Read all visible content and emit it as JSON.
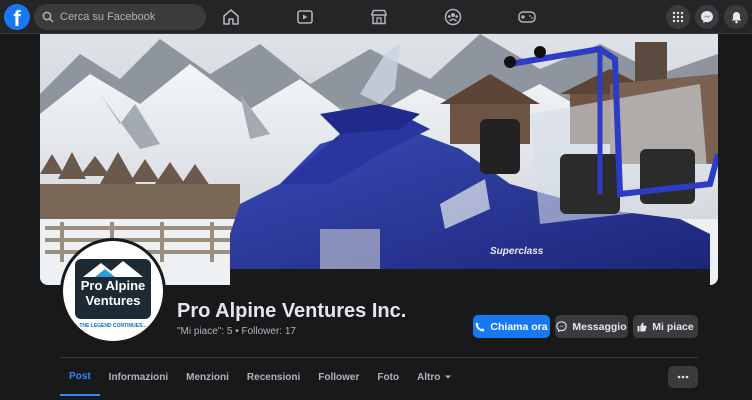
{
  "topbar": {
    "search_placeholder": "Cerca su Facebook",
    "logo_letter": "f"
  },
  "page": {
    "name": "Pro Alpine Ventures Inc.",
    "stats": "\"Mi piace\": 5 • Follower: 17",
    "logo_line1": "Pro Alpine",
    "logo_line2": "Ventures",
    "logo_tagline": "THE LEGEND CONTINUES..."
  },
  "actions": {
    "call": "Chiama ora",
    "message": "Messaggio",
    "like": "Mi piace"
  },
  "tabs": [
    {
      "label": "Post"
    },
    {
      "label": "Informazioni"
    },
    {
      "label": "Menzioni"
    },
    {
      "label": "Recensioni"
    },
    {
      "label": "Follower"
    },
    {
      "label": "Foto"
    },
    {
      "label": "Altro"
    }
  ],
  "colors": {
    "accent": "#1877f2",
    "background": "#18191a",
    "surface": "#242526"
  }
}
